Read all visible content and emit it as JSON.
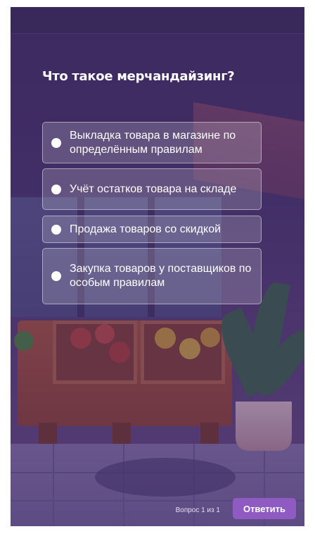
{
  "quiz": {
    "question": "Что такое мерчандайзинг?",
    "options": [
      {
        "label": "Выкладка товара в магазине по определённым правилам",
        "selected": false
      },
      {
        "label": "Учёт остатков товара на складе",
        "selected": false
      },
      {
        "label": "Продажа товаров со скидкой",
        "selected": false
      },
      {
        "label": "Закупка товаров у поставщиков по особым правилам",
        "selected": false
      }
    ]
  },
  "footer": {
    "counter": "Вопрос 1 из 1",
    "submit_label": "Ответить"
  },
  "colors": {
    "background_overlay": "#4a3470",
    "submit_button": "#8f5bc2",
    "text": "#ffffff"
  }
}
